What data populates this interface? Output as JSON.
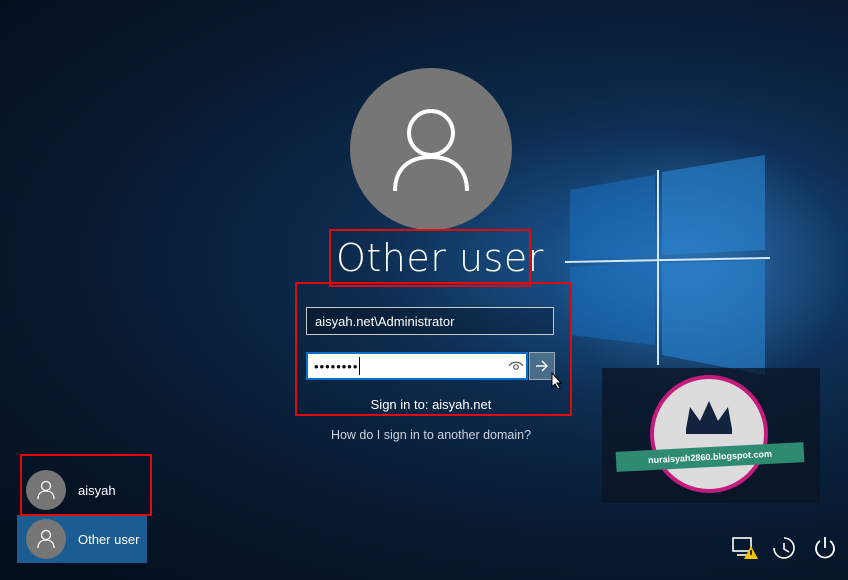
{
  "login": {
    "title": "Other user",
    "username_value": "aisyah.net\\Administrator",
    "password_mask": "••••••••",
    "sign_in_to": "Sign in to: aisyah.net",
    "domain_help_link": "How do I sign in to another domain?"
  },
  "users": [
    {
      "name": "aisyah",
      "selected": false
    },
    {
      "name": "Other user",
      "selected": true
    }
  ],
  "watermark": {
    "text": "nuraisyah2860.blogspot.com"
  },
  "system_icons": [
    "network-warning-icon",
    "ease-of-access-icon",
    "power-icon"
  ],
  "colors": {
    "highlight": "#e10a0a",
    "selected_user_bg": "#1b5c92",
    "avatar_gray": "#767676"
  }
}
